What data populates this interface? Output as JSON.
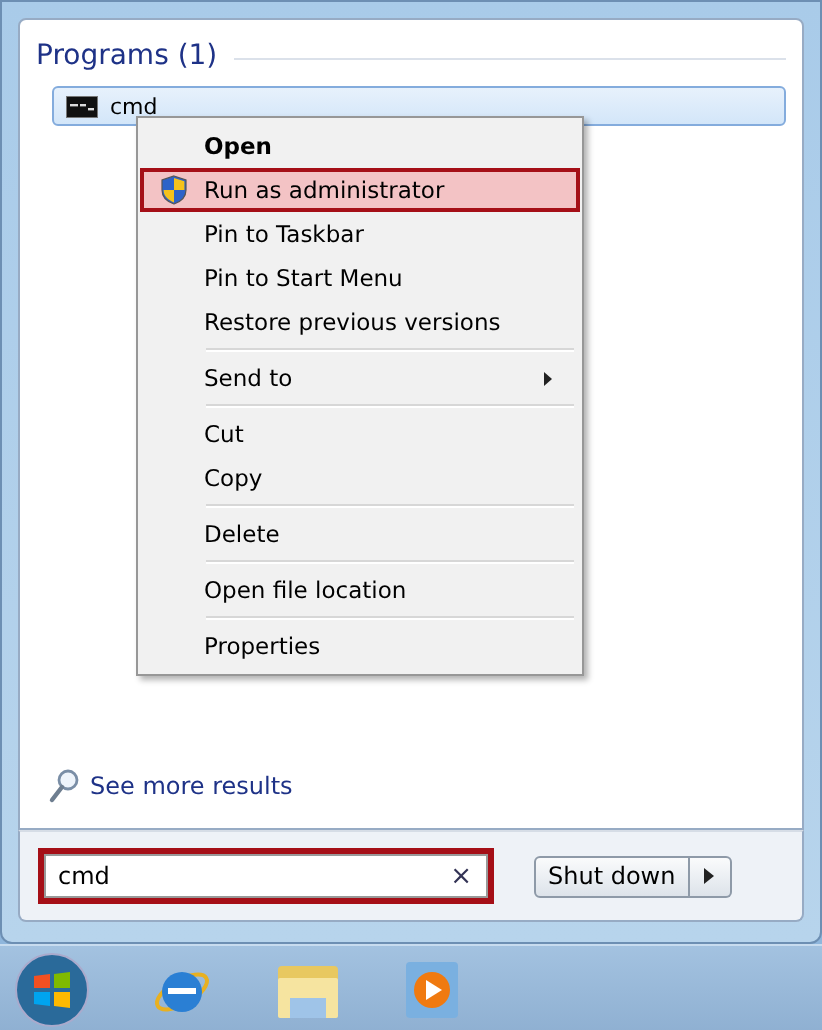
{
  "results": {
    "heading": "Programs (1)",
    "items": [
      {
        "label": "cmd",
        "selected": true
      }
    ]
  },
  "context_menu": {
    "groups": [
      [
        {
          "label": "Open",
          "default": true,
          "selected": false,
          "submenu": false,
          "has_icon": false
        },
        {
          "label": "Run as administrator",
          "default": false,
          "selected": true,
          "submenu": false,
          "has_icon": true
        },
        {
          "label": "Pin to Taskbar",
          "default": false,
          "selected": false,
          "submenu": false,
          "has_icon": false
        },
        {
          "label": "Pin to Start Menu",
          "default": false,
          "selected": false,
          "submenu": false,
          "has_icon": false
        },
        {
          "label": "Restore previous versions",
          "default": false,
          "selected": false,
          "submenu": false,
          "has_icon": false
        }
      ],
      [
        {
          "label": "Send to",
          "default": false,
          "selected": false,
          "submenu": true,
          "has_icon": false
        }
      ],
      [
        {
          "label": "Cut",
          "default": false,
          "selected": false,
          "submenu": false,
          "has_icon": false
        },
        {
          "label": "Copy",
          "default": false,
          "selected": false,
          "submenu": false,
          "has_icon": false
        }
      ],
      [
        {
          "label": "Delete",
          "default": false,
          "selected": false,
          "submenu": false,
          "has_icon": false
        }
      ],
      [
        {
          "label": "Open file location",
          "default": false,
          "selected": false,
          "submenu": false,
          "has_icon": false
        }
      ],
      [
        {
          "label": "Properties",
          "default": false,
          "selected": false,
          "submenu": false,
          "has_icon": false
        }
      ]
    ]
  },
  "see_more": "See more results",
  "search": {
    "value": "cmd",
    "clear": "×",
    "outlined": true
  },
  "shutdown": {
    "label": "Shut down"
  }
}
